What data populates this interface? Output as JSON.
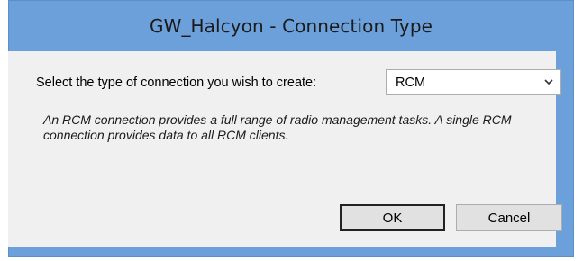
{
  "window": {
    "title": "GW_Halcyon - Connection Type"
  },
  "form": {
    "prompt": "Select the type of connection you wish to create:",
    "connection_type": {
      "selected": "RCM"
    },
    "description": "An RCM connection provides a full range of radio management tasks.  A single RCM connection provides data to all RCM clients."
  },
  "buttons": {
    "ok_label": "OK",
    "cancel_label": "Cancel"
  },
  "icons": {
    "dropdown": "chevron-down-icon"
  },
  "colors": {
    "title_bar": "#6ca0da",
    "dialog_background": "#f0f0f0",
    "button_face": "#e1e1e1"
  }
}
